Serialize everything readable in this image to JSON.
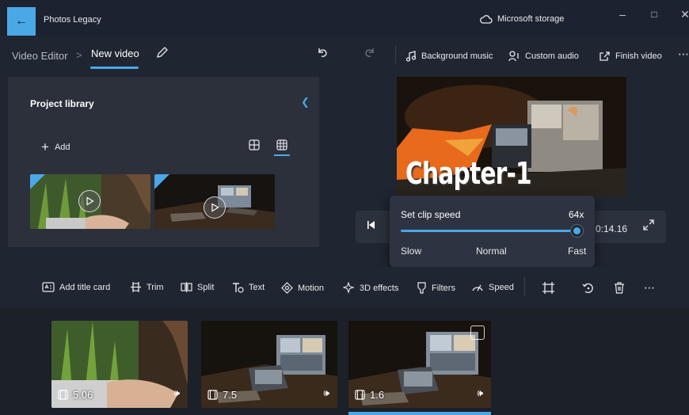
{
  "titlebar": {
    "app_title": "Photos Legacy",
    "storage_label": "Microsoft storage",
    "back_icon": "arrow-left-icon",
    "window_controls": [
      "minimize",
      "maximize",
      "close"
    ]
  },
  "toolbar": {
    "breadcrumb_root": "Video Editor",
    "breadcrumb_separator": ">",
    "breadcrumb_current": "New video",
    "background_music_label": "Background music",
    "custom_audio_label": "Custom audio",
    "finish_video_label": "Finish video"
  },
  "library": {
    "title": "Project library",
    "add_label": "Add",
    "view_modes": [
      "small-grid",
      "large-grid"
    ],
    "selected_view": "large-grid"
  },
  "player": {
    "time": "0:14.16",
    "preview_caption": "Chapter-1"
  },
  "speed_popup": {
    "title": "Set clip speed",
    "value": "64x",
    "slider_fraction": 1.0,
    "labels": [
      "Slow",
      "Normal",
      "Fast"
    ]
  },
  "edit_tools": {
    "add_title_card": "Add title card",
    "trim": "Trim",
    "split": "Split",
    "text": "Text",
    "motion": "Motion",
    "effects_3d": "3D effects",
    "filters": "Filters",
    "speed": "Speed"
  },
  "storyboard": {
    "clips": [
      {
        "duration": "5.06"
      },
      {
        "duration": "7.5"
      },
      {
        "duration": "1.6"
      }
    ],
    "selected_clip": 3
  },
  "colors": {
    "accent": "#4ba8e6",
    "background": "#1f2632",
    "panel": "#2b303b"
  }
}
